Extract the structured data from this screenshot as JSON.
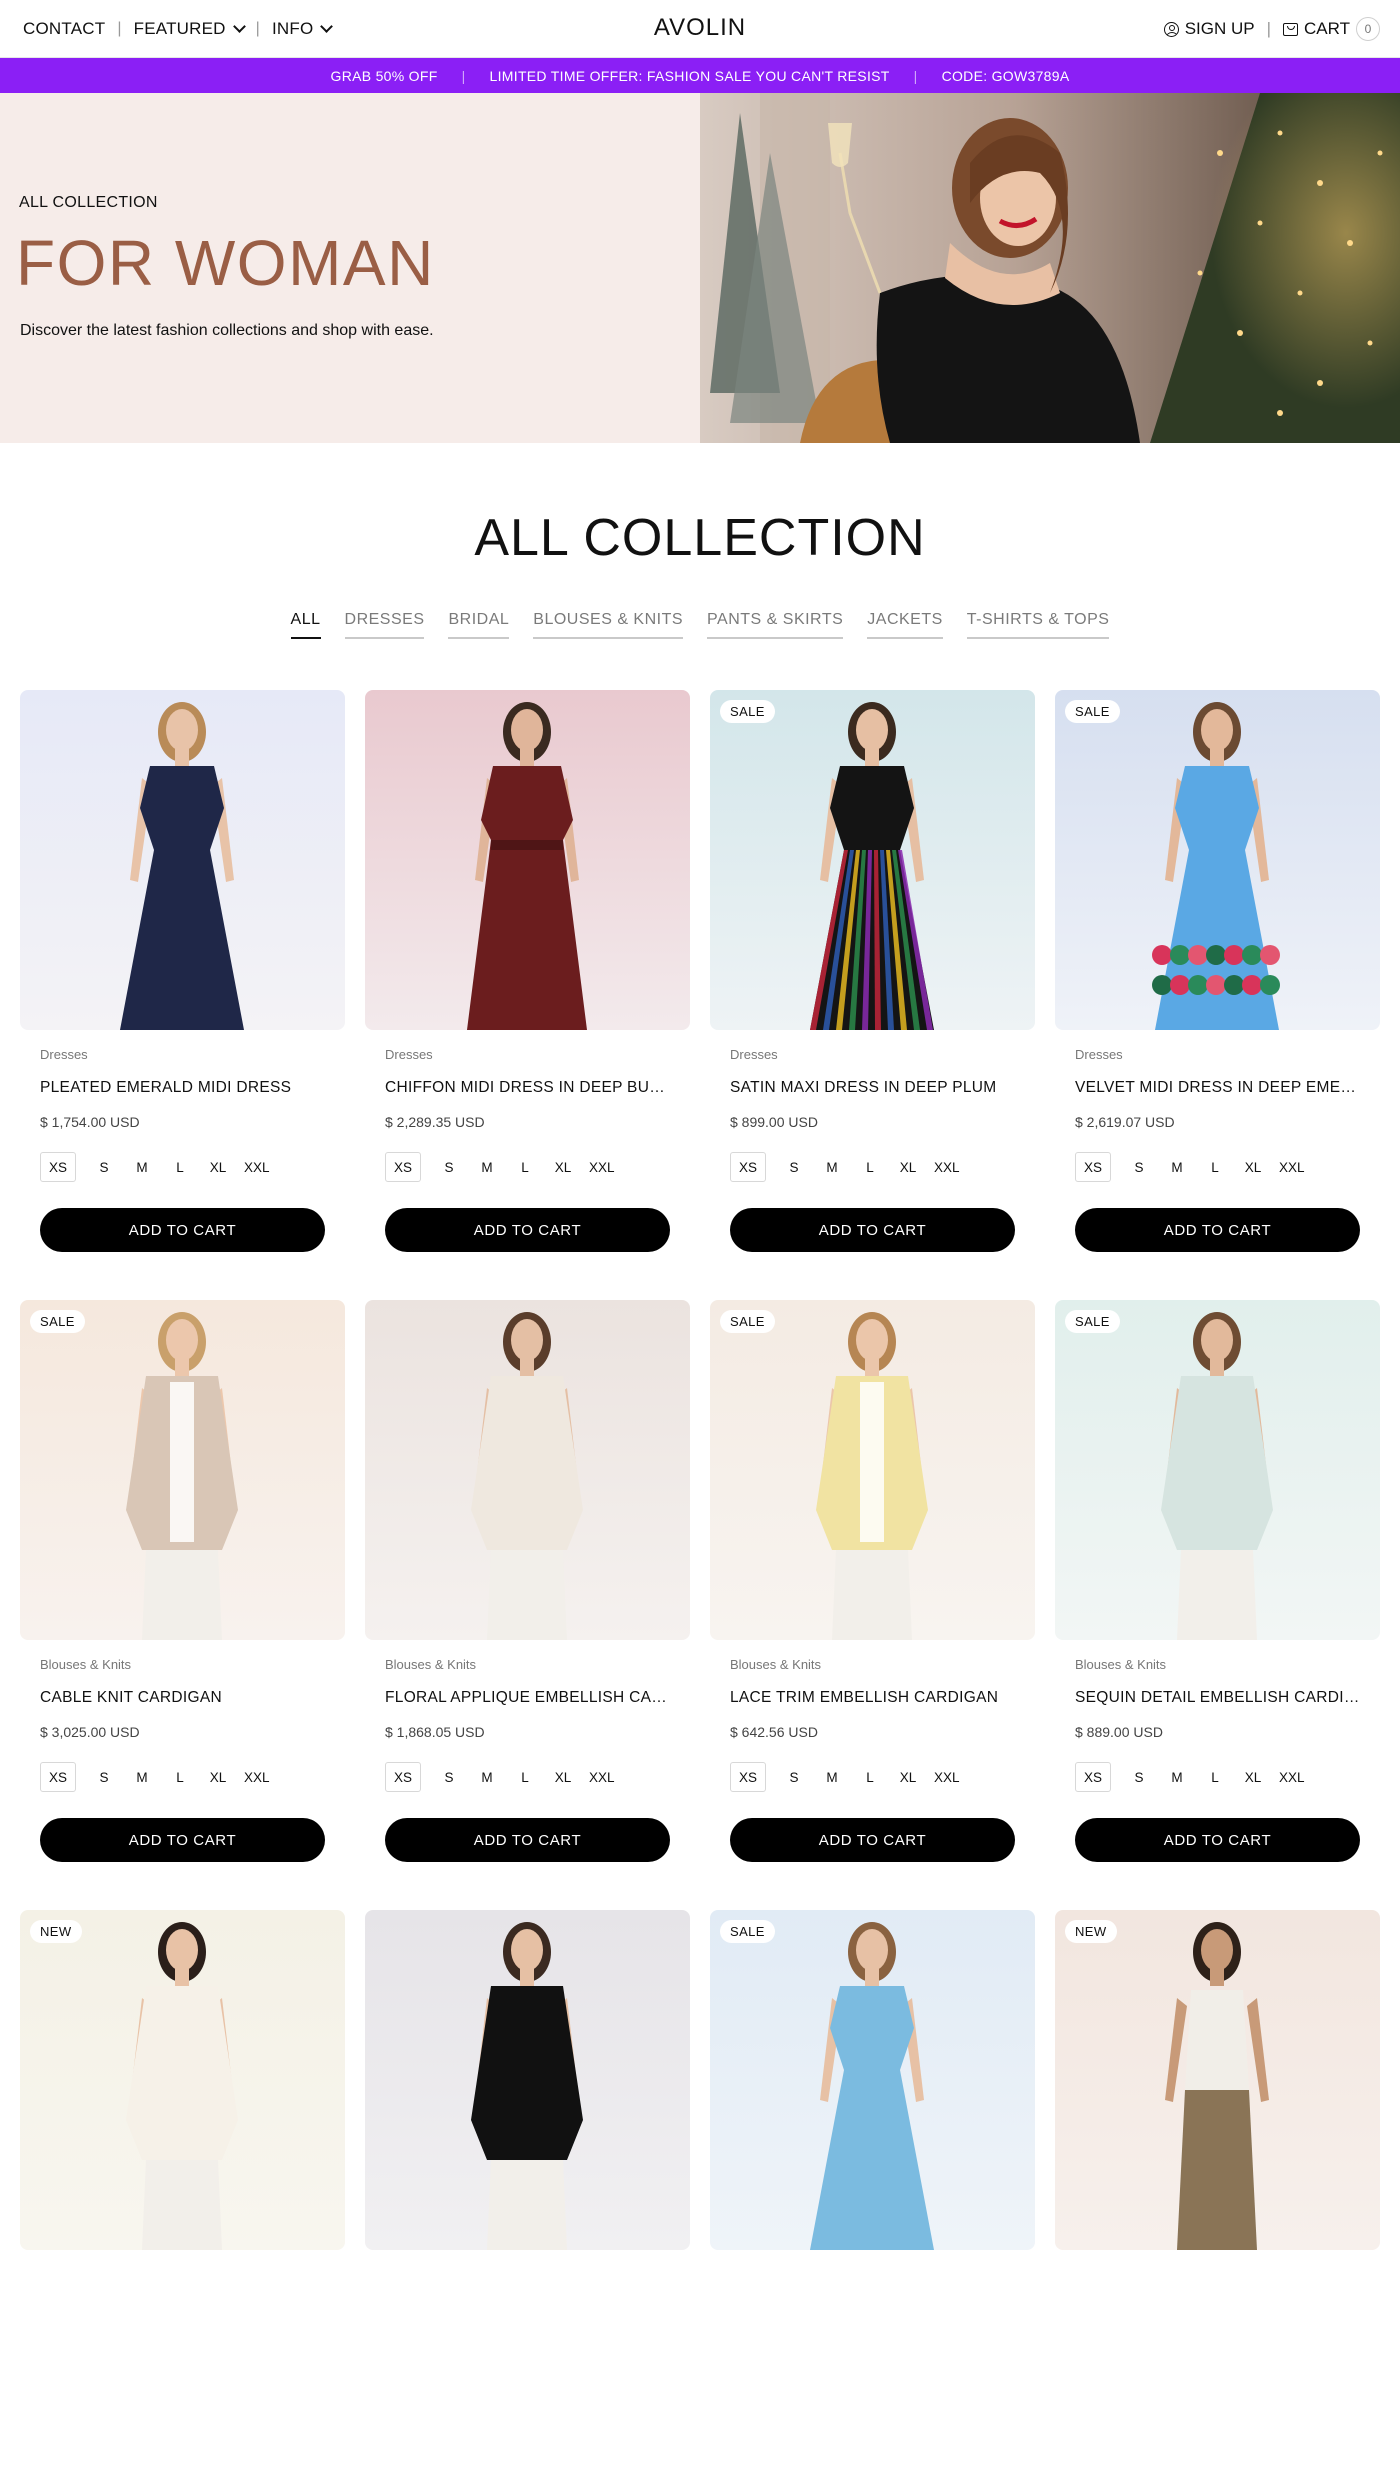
{
  "nav": {
    "contact": "CONTACT",
    "featured": "FEATURED",
    "info": "INFO",
    "brand": "AVOLIN",
    "signup": "SIGN UP",
    "cart": "CART",
    "cart_count": "0"
  },
  "promo": {
    "items": [
      "GRAB 50% OFF",
      "LIMITED TIME OFFER: FASHION SALE YOU CAN'T RESIST",
      "CODE: GOW3789A"
    ],
    "color": "#8b1ff5"
  },
  "hero": {
    "subtitle": "ALL COLLECTION",
    "title": "FOR WOMAN",
    "description": "Discover the latest fashion collections and shop with ease.",
    "title_color": "#9a5e45",
    "bg_color": "#f6ece9"
  },
  "collection": {
    "title": "ALL COLLECTION",
    "tabs": [
      "ALL",
      "DRESSES",
      "BRIDAL",
      "BLOUSES & KNITS",
      "PANTS & SKIRTS",
      "JACKETS",
      "T-SHIRTS & TOPS"
    ],
    "active_tab": "ALL"
  },
  "sizes": [
    "XS",
    "S",
    "M",
    "L",
    "XL",
    "XXL"
  ],
  "add_to_cart": "ADD TO CART",
  "products": [
    {
      "badge": "",
      "category": "Dresses",
      "name": "PLEATED EMERALD MIDI DRESS",
      "price": "$ 1,754.00 USD",
      "bg": [
        "#e6e9f7",
        "#f4f3f6"
      ],
      "garment": "#1f2748",
      "skin": "#e8c3a8",
      "hair": "#b98b58",
      "shape": "dress"
    },
    {
      "badge": "",
      "category": "Dresses",
      "name": "CHIFFON MIDI DRESS IN DEEP BURGUNDY",
      "price": "$ 2,289.35 USD",
      "bg": [
        "#e9c9cf",
        "#f3eaec"
      ],
      "garment": "#6b1d1e",
      "skin": "#e0b59a",
      "hair": "#3a2a20",
      "shape": "longdress"
    },
    {
      "badge": "SALE",
      "category": "Dresses",
      "name": "SATIN MAXI DRESS IN DEEP PLUM",
      "price": "$ 899.00 USD",
      "bg": [
        "#d3e6ea",
        "#eef3f5"
      ],
      "garment": "#141414",
      "skin": "#e6bfa3",
      "hair": "#3b2a1f",
      "shape": "pleated"
    },
    {
      "badge": "SALE",
      "category": "Dresses",
      "name": "VELVET MIDI DRESS IN DEEP EMERALD",
      "price": "$ 2,619.07 USD",
      "bg": [
        "#d6dff0",
        "#eff2f8"
      ],
      "garment": "#5aa8e4",
      "skin": "#e3b89a",
      "hair": "#6b4a32",
      "shape": "floral"
    },
    {
      "badge": "SALE",
      "category": "Blouses & Knits",
      "name": "CABLE KNIT CARDIGAN",
      "price": "$ 3,025.00 USD",
      "bg": [
        "#f5e8dd",
        "#f8f2ee"
      ],
      "garment": "#d9c6b6",
      "skin": "#ecc7ac",
      "hair": "#c9a06b",
      "shape": "cardigan"
    },
    {
      "badge": "",
      "category": "Blouses & Knits",
      "name": "FLORAL APPLIQUE EMBELLISH CARDIGAN",
      "price": "$ 1,868.05 USD",
      "bg": [
        "#ebe3df",
        "#f5f1ef"
      ],
      "garment": "#efe8df",
      "skin": "#e4bfa4",
      "hair": "#5a3d2b",
      "shape": "blouse"
    },
    {
      "badge": "SALE",
      "category": "Blouses & Knits",
      "name": "LACE TRIM EMBELLISH CARDIGAN",
      "price": "$ 642.56 USD",
      "bg": [
        "#f4ebe3",
        "#f8f4f0"
      ],
      "garment": "#f1e3a2",
      "skin": "#ebc6aa",
      "hair": "#b68653",
      "shape": "cardigan"
    },
    {
      "badge": "SALE",
      "category": "Blouses & Knits",
      "name": "SEQUIN DETAIL EMBELLISH CARDIGAN",
      "price": "$ 889.00 USD",
      "bg": [
        "#e1efec",
        "#f2f6f5"
      ],
      "garment": "#d6e4e0",
      "skin": "#e2b99b",
      "hair": "#6e4c33",
      "shape": "sweater"
    },
    {
      "badge": "NEW",
      "category": "",
      "name": "",
      "price": "",
      "bg": [
        "#f4f1e6",
        "#f8f6ef"
      ],
      "garment": "#f6f1e8",
      "skin": "#e8c2a6",
      "hair": "#2b1f1a",
      "shape": "blouse"
    },
    {
      "badge": "",
      "category": "",
      "name": "",
      "price": "",
      "bg": [
        "#e6e4e8",
        "#f1f0f2"
      ],
      "garment": "#111111",
      "skin": "#e6c0a4",
      "hair": "#3b2a21",
      "shape": "sweater"
    },
    {
      "badge": "SALE",
      "category": "",
      "name": "",
      "price": "",
      "bg": [
        "#e1ebf5",
        "#eff4f9"
      ],
      "garment": "#7bbbe0",
      "skin": "#e7c1a5",
      "hair": "#8a6240",
      "shape": "dress"
    },
    {
      "badge": "NEW",
      "category": "",
      "name": "",
      "price": "",
      "bg": [
        "#f2e6df",
        "#f7f0ec"
      ],
      "garment": "#f1eee8",
      "skin": "#c89a78",
      "hair": "#2e2119",
      "shape": "tank"
    }
  ]
}
